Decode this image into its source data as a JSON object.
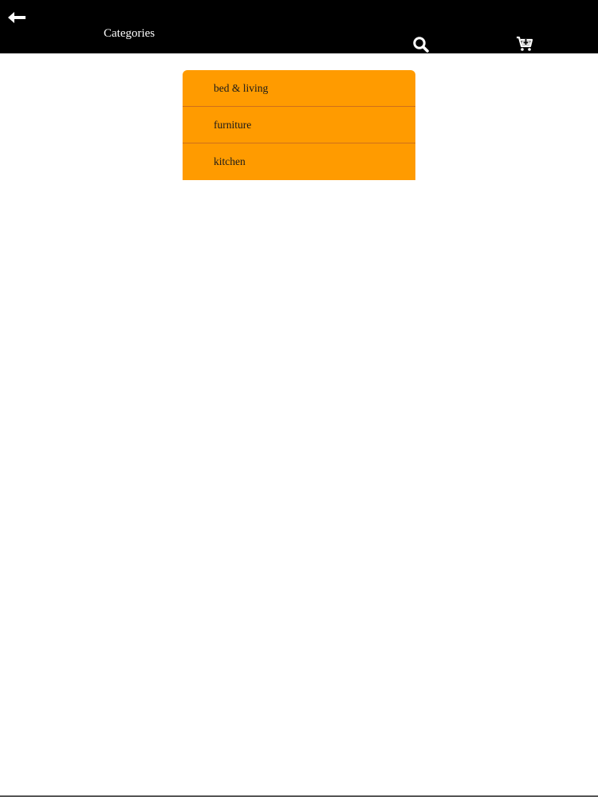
{
  "header": {
    "title": "Categories",
    "back_icon": "arrow-left-icon",
    "search_icon": "search-icon",
    "cart_icon": "cart-plus-icon",
    "background": "#000000",
    "foreground": "#ffffff"
  },
  "categories": {
    "accent": "#ff9b00",
    "divider": "#d0701b",
    "items": [
      {
        "label": "bed & living"
      },
      {
        "label": "furniture"
      },
      {
        "label": "kitchen"
      }
    ]
  }
}
